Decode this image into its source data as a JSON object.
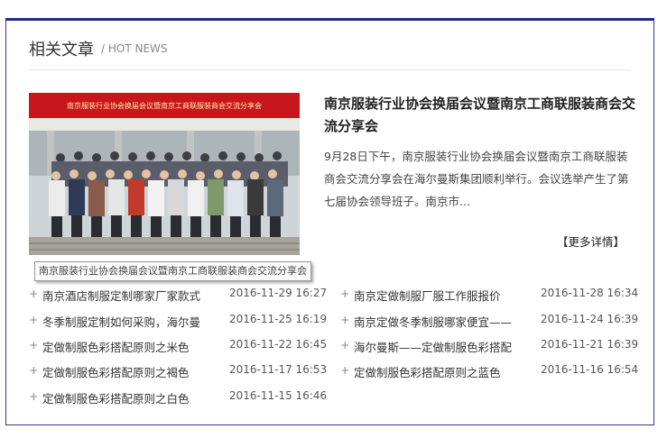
{
  "header": {
    "title": "相关文章",
    "subtitle": "/ HOT NEWS"
  },
  "featured": {
    "image_banner": "南京服装行业协会换届会议暨南京工商联服装商会交流分享会",
    "caption": "南京服装行业协会换届会议暨南京工商联服装商会交流分享会",
    "title": "南京服装行业协会换届会议暨南京工商联服装商会交流分享会",
    "summary": "9月28日下午，南京服装行业协会换届会议暨南京工商联服装商会交流分享会在海尔曼斯集团顺利举行。会议选举产生了第七届协会领导班子。南京市...",
    "more_label": "【更多详情】"
  },
  "news": [
    {
      "title": "南京酒店制服定制哪家厂家款式",
      "date": "2016-11-29 16:27"
    },
    {
      "title": "南京定做制服厂服工作服报价",
      "date": "2016-11-28 16:34"
    },
    {
      "title": "冬季制服定制如何采购，海尔曼",
      "date": "2016-11-25 16:19"
    },
    {
      "title": "南京定做冬季制服哪家便宜——",
      "date": "2016-11-24 16:39"
    },
    {
      "title": "定做制服色彩搭配原则之米色",
      "date": "2016-11-22 16:45"
    },
    {
      "title": "海尔曼斯——定做制服色彩搭配",
      "date": "2016-11-21 16:39"
    },
    {
      "title": "定做制服色彩搭配原则之褐色",
      "date": "2016-11-17 16:53"
    },
    {
      "title": "定做制服色彩搭配原则之蓝色",
      "date": "2016-11-16 16:54"
    },
    {
      "title": "定做制服色彩搭配原则之白色",
      "date": "2016-11-15 16:46"
    }
  ],
  "colors": {
    "border": "#1c2a86",
    "banner_red": "#c8161d"
  }
}
